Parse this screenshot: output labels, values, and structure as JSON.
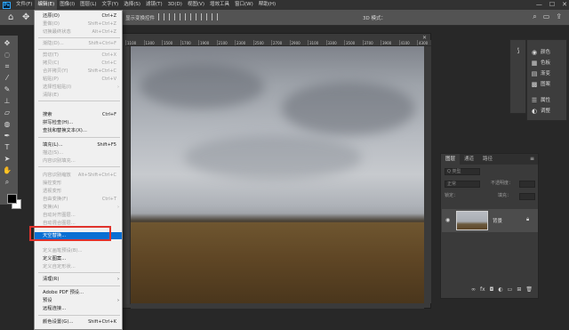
{
  "menubar": {
    "logo": "Ps",
    "items": [
      "文件(F)",
      "编辑(E)",
      "图像(I)",
      "图层(L)",
      "文字(Y)",
      "选择(S)",
      "滤镜(T)",
      "3D(D)",
      "视图(V)",
      "增效工具",
      "窗口(W)",
      "帮助(H)"
    ],
    "window_controls": [
      "—",
      "☐",
      "✕"
    ]
  },
  "options_bar": {
    "transform_label": "显示变换控件",
    "mode_3d": "3D 模式："
  },
  "edit_menu": {
    "items": [
      {
        "label": "还原(O)",
        "shortcut": "Ctrl+Z",
        "disabled": false
      },
      {
        "label": "重做(O)",
        "shortcut": "Shift+Ctrl+Z",
        "disabled": true
      },
      {
        "label": "切换最终状态",
        "shortcut": "Alt+Ctrl+Z",
        "disabled": true
      },
      {
        "label": "渐隐(D)...",
        "shortcut": "Shift+Ctrl+F",
        "disabled": true
      },
      {
        "label": "剪切(T)",
        "shortcut": "Ctrl+X",
        "disabled": true
      },
      {
        "label": "拷贝(C)",
        "shortcut": "Ctrl+C",
        "disabled": true
      },
      {
        "label": "合并拷贝(Y)",
        "shortcut": "Shift+Ctrl+C",
        "disabled": true
      },
      {
        "label": "粘贴(P)",
        "shortcut": "Ctrl+V",
        "disabled": true
      },
      {
        "label": "选择性粘贴(I)",
        "shortcut": "",
        "disabled": true,
        "submenu": true
      },
      {
        "label": "清除(E)",
        "shortcut": "",
        "disabled": true
      },
      {
        "label": "搜索",
        "shortcut": "Ctrl+F",
        "disabled": false
      },
      {
        "label": "拼写检查(H)...",
        "shortcut": "",
        "disabled": false
      },
      {
        "label": "查找和替换文本(X)...",
        "shortcut": "",
        "disabled": false
      },
      {
        "label": "填充(L)...",
        "shortcut": "Shift+F5",
        "disabled": false
      },
      {
        "label": "描边(S)...",
        "shortcut": "",
        "disabled": true
      },
      {
        "label": "内容识别填充...",
        "shortcut": "",
        "disabled": true
      },
      {
        "label": "内容识别缩放",
        "shortcut": "Alt+Shift+Ctrl+C",
        "disabled": true
      },
      {
        "label": "操控变形",
        "shortcut": "",
        "disabled": true
      },
      {
        "label": "透视变形",
        "shortcut": "",
        "disabled": true
      },
      {
        "label": "自由变换(F)",
        "shortcut": "Ctrl+T",
        "disabled": true
      },
      {
        "label": "变换(A)",
        "shortcut": "",
        "disabled": true,
        "submenu": true
      },
      {
        "label": "自动对齐图层...",
        "shortcut": "",
        "disabled": true
      },
      {
        "label": "自动混合图层...",
        "shortcut": "",
        "disabled": true
      },
      {
        "label": "天空替换...",
        "shortcut": "",
        "disabled": false,
        "highlight": true
      },
      {
        "label": "定义画笔预设(B)...",
        "shortcut": "",
        "disabled": true
      },
      {
        "label": "定义图案...",
        "shortcut": "",
        "disabled": false
      },
      {
        "label": "定义自定形状...",
        "shortcut": "",
        "disabled": true
      },
      {
        "label": "清理(R)",
        "shortcut": "",
        "disabled": false,
        "submenu": true
      },
      {
        "label": "Adobe PDF 预设...",
        "shortcut": "",
        "disabled": false
      },
      {
        "label": "预设",
        "shortcut": "",
        "disabled": false,
        "submenu": true
      },
      {
        "label": "远程连接...",
        "shortcut": "",
        "disabled": false
      },
      {
        "label": "颜色设置(G)...",
        "shortcut": "Shift+Ctrl+K",
        "disabled": false
      }
    ]
  },
  "ruler": {
    "ticks": [
      "1100",
      "1300",
      "1500",
      "1700",
      "1900",
      "2100",
      "2300",
      "2500",
      "2700",
      "2900",
      "3100",
      "3300",
      "3500",
      "3700",
      "3900",
      "4100",
      "4300"
    ]
  },
  "right_panel": {
    "items": [
      {
        "icon": "color-icon",
        "label": "颜色"
      },
      {
        "icon": "swatches-icon",
        "label": "色板"
      },
      {
        "icon": "gradient-icon",
        "label": "渐变"
      },
      {
        "icon": "pattern-icon",
        "label": "图案"
      },
      {
        "icon": "properties-icon",
        "label": "属性"
      },
      {
        "icon": "adjustments-icon",
        "label": "调整"
      }
    ]
  },
  "layers_panel": {
    "tabs": [
      "图层",
      "通道",
      "路径"
    ],
    "filter_placeholder": "Q 类型",
    "blend_mode": "正常",
    "opacity_label": "不透明度：",
    "lock_label": "锁定：",
    "fill_label": "填充：",
    "layer_name": "背景"
  },
  "colors": {
    "highlight": "#0a6fd3",
    "callout": "#e0332c"
  }
}
